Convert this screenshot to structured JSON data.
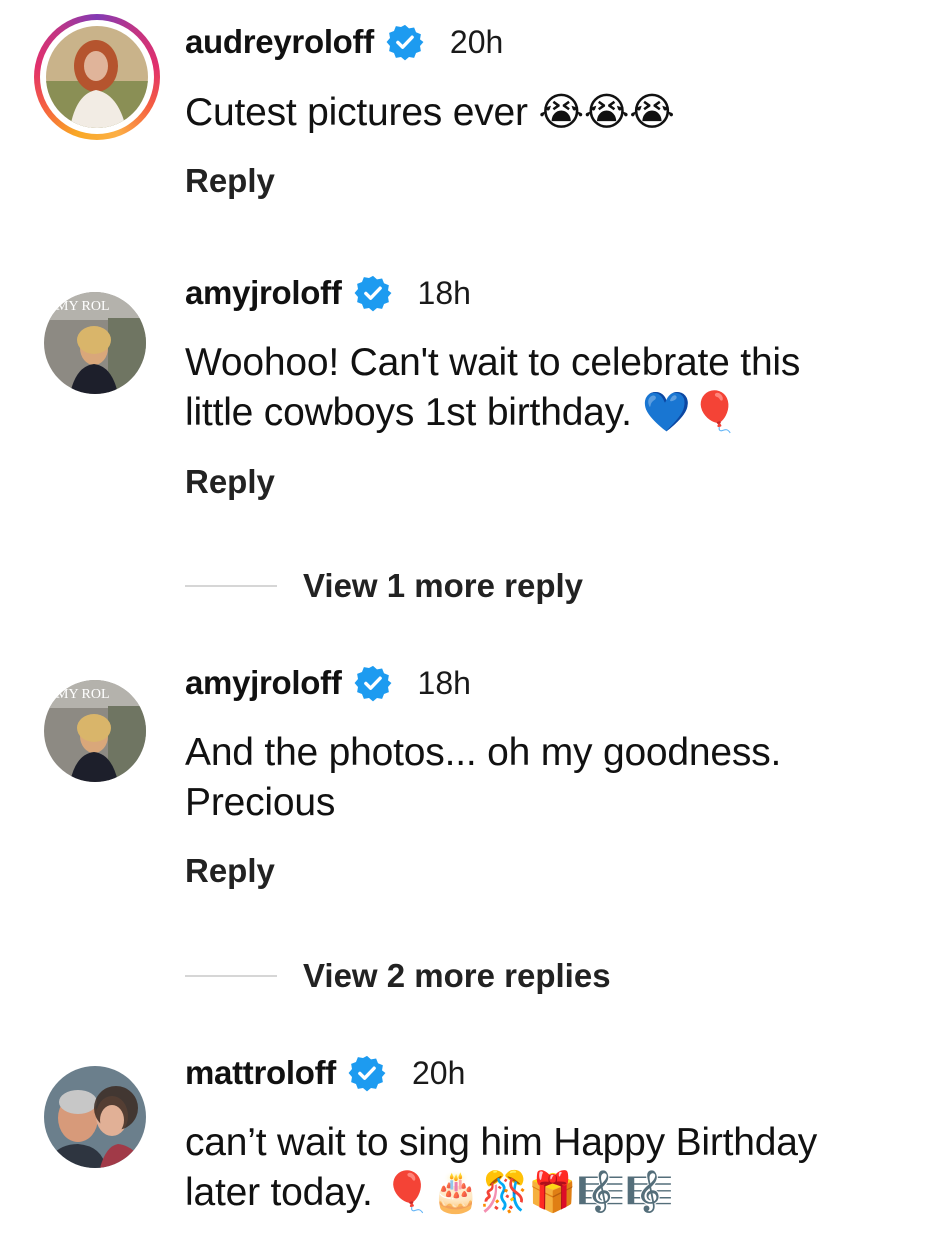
{
  "comments": [
    {
      "username": "audreyroloff",
      "time": "20h",
      "text": "Cutest pictures ever",
      "emojis": "😭😭😭",
      "reply_label": "Reply",
      "avatar_icon": "profile-photo"
    },
    {
      "username": "amyjroloff",
      "time": "18h",
      "text_line1": "Woohoo!  Can't wait to celebrate this",
      "text_line2": "little cowboys 1st birthday.",
      "emojis": "💙🎈",
      "reply_label": "Reply",
      "view_more": "View 1 more reply",
      "avatar_icon": "profile-photo"
    },
    {
      "username": "amyjroloff",
      "time": "18h",
      "text_line1": "And the photos... oh my goodness.",
      "text_line2": "Precious",
      "reply_label": "Reply",
      "view_more": "View 2 more replies",
      "avatar_icon": "profile-photo"
    },
    {
      "username": "mattroloff",
      "time": "20h",
      "text_line1": "can’t wait to sing him Happy Birthday",
      "text_line2": "later today.",
      "emojis": "🎈🎂🎊🎁🎼🎼",
      "avatar_icon": "profile-photo"
    }
  ],
  "icons": {
    "verified": "verified-badge-icon"
  },
  "colors": {
    "verified_blue": "#1d9bf0",
    "text": "#111111",
    "divider": "#d6d6d6"
  }
}
